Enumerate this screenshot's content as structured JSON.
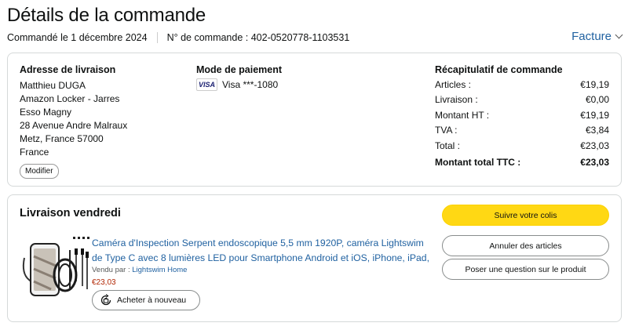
{
  "page": {
    "title": "Détails de la commande",
    "ordered_on": "Commandé le 1 décembre 2024",
    "order_number": "N° de commande : 402-0520778-1103531",
    "invoice_label": "Facture"
  },
  "shipping": {
    "title": "Adresse de livraison",
    "lines": [
      "Matthieu DUGA",
      "Amazon Locker - Jarres",
      "Esso Magny",
      "28 Avenue Andre Malraux",
      "Metz, France 57000",
      "France"
    ],
    "modify_label": "Modifier"
  },
  "payment": {
    "title": "Mode de paiement",
    "card_logo": "VISA",
    "card_text": "Visa ***-1080"
  },
  "summary": {
    "title": "Récapitulatif de commande",
    "rows": [
      {
        "label": "Articles :",
        "value": "€19,19"
      },
      {
        "label": "Livraison :",
        "value": "€0,00"
      },
      {
        "label": "Montant HT :",
        "value": "€19,19"
      },
      {
        "label": "TVA :",
        "value": "€3,84"
      },
      {
        "label": "Total :",
        "value": "€23,03"
      },
      {
        "label": "Montant total TTC :",
        "value": "€23,03"
      }
    ]
  },
  "delivery": {
    "title": "Livraison vendredi",
    "product_title": "Caméra d'Inspection Serpent endoscopique 5,5 mm 1920P, caméra Lightswim de Type C avec 8 lumières LED pour Smartphone Android et iOS, iPhone, iPad,",
    "sold_by_prefix": "Vendu par :",
    "seller": "Lightswim Home",
    "price": "€23,03",
    "rebuy_label": "Acheter à nouveau",
    "actions": {
      "track": "Suivre votre colis",
      "cancel": "Annuler des articles",
      "question": "Poser une question sur le produit"
    }
  },
  "icons": {
    "invoice": "chevron-down-icon",
    "rebuy": "rebuy-icon",
    "card": "visa-icon"
  },
  "colors": {
    "link": "#2162a1",
    "price": "#b12704",
    "primary_button": "#ffd814",
    "border": "#d5d9d9"
  }
}
